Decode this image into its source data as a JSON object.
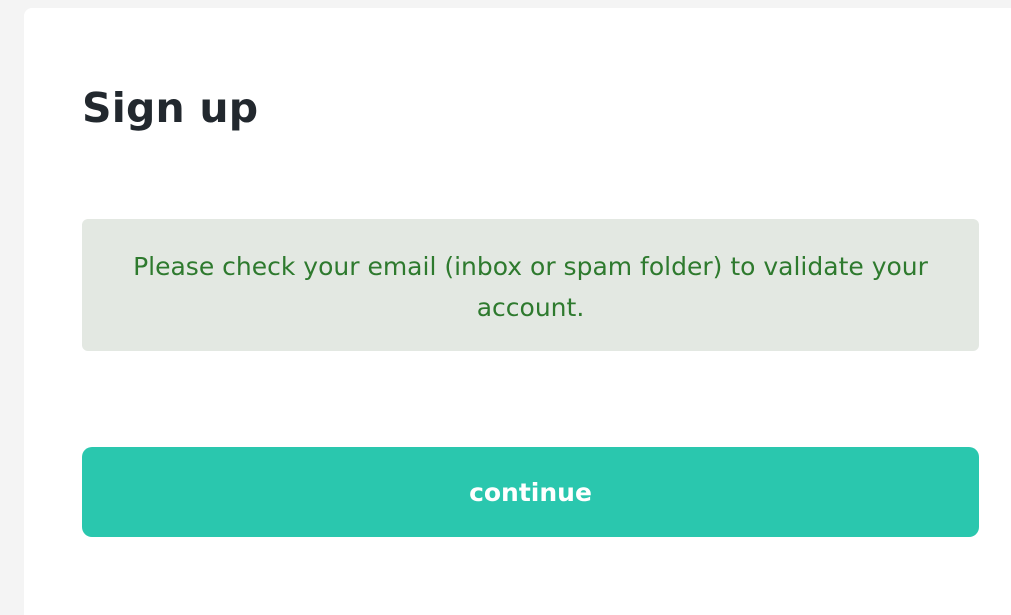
{
  "signup": {
    "title": "Sign up",
    "notice": "Please check your email (inbox or spam folder) to validate your account.",
    "continue_label": "continue"
  },
  "colors": {
    "accent": "#2ac7ae",
    "notice_background": "#e3e8e2",
    "notice_text": "#2e7a2e"
  }
}
